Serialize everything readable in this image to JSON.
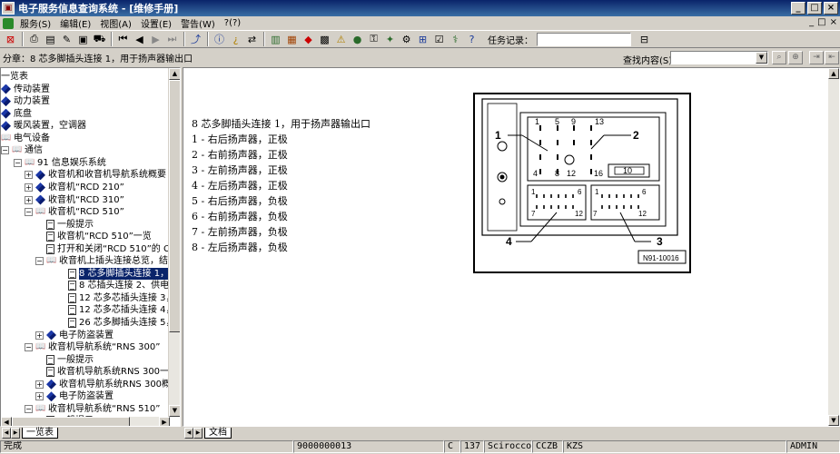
{
  "window": {
    "title": "电子服务信息查询系统 - [维修手册]",
    "min": "_",
    "max": "□",
    "close": "×"
  },
  "menu": [
    "服务(S)",
    "编辑(E)",
    "视图(A)",
    "设置(E)",
    "警告(W)",
    "?(?)"
  ],
  "mdi_buttons": [
    "_",
    "□",
    "×"
  ],
  "toolbar": {
    "task_label": "任务记录：",
    "task_value": ""
  },
  "infobar": {
    "breadcrumb": "分章：8 芯多脚插头连接 1，用于扬声器输出口",
    "search_label": "查找内容(S)：",
    "search_value": ""
  },
  "tree": [
    {
      "label": "一览表",
      "level": 0,
      "icon": "none",
      "exp": ""
    },
    {
      "label": "传动装置",
      "level": 0,
      "icon": "book-closed",
      "exp": ""
    },
    {
      "label": "动力装置",
      "level": 0,
      "icon": "book-closed",
      "exp": ""
    },
    {
      "label": "底盘",
      "level": 0,
      "icon": "book-closed",
      "exp": ""
    },
    {
      "label": "暖风装置，空调器",
      "level": 0,
      "icon": "book-closed",
      "exp": ""
    },
    {
      "label": "电气设备",
      "level": 0,
      "icon": "book-open",
      "exp": ""
    },
    {
      "label": "通信",
      "level": 0,
      "icon": "book-open",
      "exp": "-"
    },
    {
      "label": "91 信息娱乐系统",
      "level": 1,
      "icon": "book-open",
      "exp": "-"
    },
    {
      "label": "收音机和收音机导航系统概要",
      "level": 2,
      "icon": "book-closed",
      "exp": "+"
    },
    {
      "label": "收音机“RCD 210”",
      "level": 2,
      "icon": "book-closed",
      "exp": "+"
    },
    {
      "label": "收音机“RCD 310”",
      "level": 2,
      "icon": "book-closed",
      "exp": "+"
    },
    {
      "label": "收音机“RCD 510”",
      "level": 2,
      "icon": "book-open",
      "exp": "-"
    },
    {
      "label": "一般提示",
      "level": 3,
      "icon": "doc",
      "exp": ""
    },
    {
      "label": "收音机“RCD 510”一览",
      "level": 3,
      "icon": "doc",
      "exp": ""
    },
    {
      "label": "打开和关闭“RCD 510”的 C",
      "level": 3,
      "icon": "doc",
      "exp": ""
    },
    {
      "label": "收音机上插头连接总览，结",
      "level": 3,
      "icon": "book-open",
      "exp": "-"
    },
    {
      "label": "8 芯多脚插头连接 1，",
      "level": 4,
      "icon": "doc",
      "exp": "",
      "selected": true
    },
    {
      "label": "8 芯插头连接 2、供电",
      "level": 4,
      "icon": "doc",
      "exp": ""
    },
    {
      "label": "12 芯多芯插头连接 3，",
      "level": 4,
      "icon": "doc",
      "exp": ""
    },
    {
      "label": "12 芯多芯插头连接 4，",
      "level": 4,
      "icon": "doc",
      "exp": ""
    },
    {
      "label": "26 芯多脚插头连接 5，",
      "level": 4,
      "icon": "doc",
      "exp": ""
    },
    {
      "label": "电子防盗装置",
      "level": 3,
      "icon": "book-closed",
      "exp": "+"
    },
    {
      "label": "收音机导航系统“RNS 300”",
      "level": 2,
      "icon": "book-open",
      "exp": "-"
    },
    {
      "label": "一般提示",
      "level": 3,
      "icon": "doc",
      "exp": ""
    },
    {
      "label": "收音机导航系统RNS 300一",
      "level": 3,
      "icon": "doc",
      "exp": ""
    },
    {
      "label": "收音机导航系统RNS 300概",
      "level": 3,
      "icon": "book-closed",
      "exp": "+"
    },
    {
      "label": "电子防盗装置",
      "level": 3,
      "icon": "book-closed",
      "exp": "+"
    },
    {
      "label": "收音机导航系统“RNS 510”",
      "level": 2,
      "icon": "book-open",
      "exp": "-"
    },
    {
      "label": "一般提示",
      "level": 3,
      "icon": "doc",
      "exp": ""
    }
  ],
  "left_tab": "一览表",
  "right_tab": "文档",
  "document": {
    "title": "8 芯多脚插头连接 1，用于扬声器输出口",
    "pins": [
      "1 - 右后扬声器，正极",
      "2 - 右前扬声器，正极",
      "3 - 左前扬声器，正极",
      "4 - 左后扬声器，正极",
      "5 - 右后扬声器，负极",
      "6 - 右前扬声器，负极",
      "7 - 左前扬声器，负极",
      "8 - 左后扬声器，负极"
    ]
  },
  "diagram": {
    "callouts": [
      "1",
      "2",
      "3",
      "4"
    ],
    "pin_numbers_top": [
      "1",
      "5",
      "9",
      "13"
    ],
    "pin_numbers_mid": [
      "4",
      "8",
      "12",
      "16"
    ],
    "block_label": "10",
    "conn_left": [
      "1",
      "6",
      "7",
      "12"
    ],
    "conn_right": [
      "1",
      "6",
      "7",
      "12"
    ],
    "figure_id": "N91-10016"
  },
  "status": {
    "state": "完成",
    "number": "9000000013",
    "c": "C",
    "code": "137",
    "model": "Scirocco",
    "engine": "CCZB",
    "gear": "KZS",
    "user": "ADMIN"
  }
}
